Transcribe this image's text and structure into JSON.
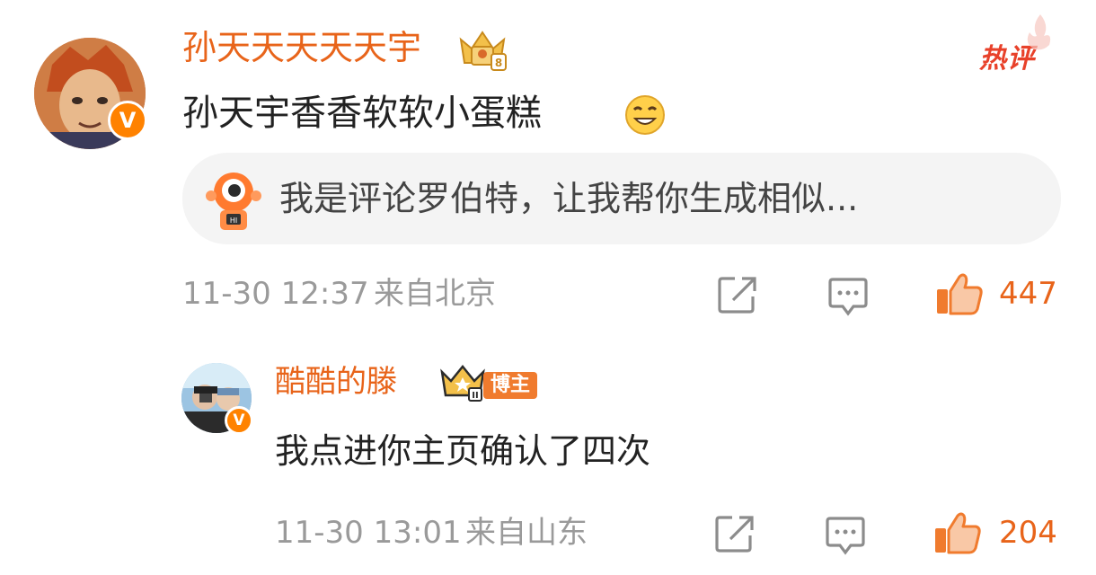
{
  "comment1": {
    "username": "孙天天天天天宇",
    "text": "孙天宇香香软软小蛋糕",
    "hot_tag": "热评",
    "bot_prompt": "我是评论罗伯特，让我帮你生成相似...",
    "time": "11-30 12:37",
    "location": "来自北京",
    "likes": "447",
    "vip_level": "8"
  },
  "reply1": {
    "username": "酷酷的滕",
    "badge": "博主",
    "text": "我点进你主页确认了四次",
    "time": "11-30 13:01",
    "location": "来自山东",
    "likes": "204",
    "crown_level": "II"
  },
  "icons": {
    "verified": "v-verified-badge",
    "share": "share-icon",
    "comment": "comment-icon",
    "like": "thumbs-up-icon",
    "emoji": "smirk-emoji-icon"
  },
  "colors": {
    "username": "#e8641a",
    "hot": "#e8412a",
    "meta": "#9a9a9a",
    "like": "#f07b2e"
  }
}
